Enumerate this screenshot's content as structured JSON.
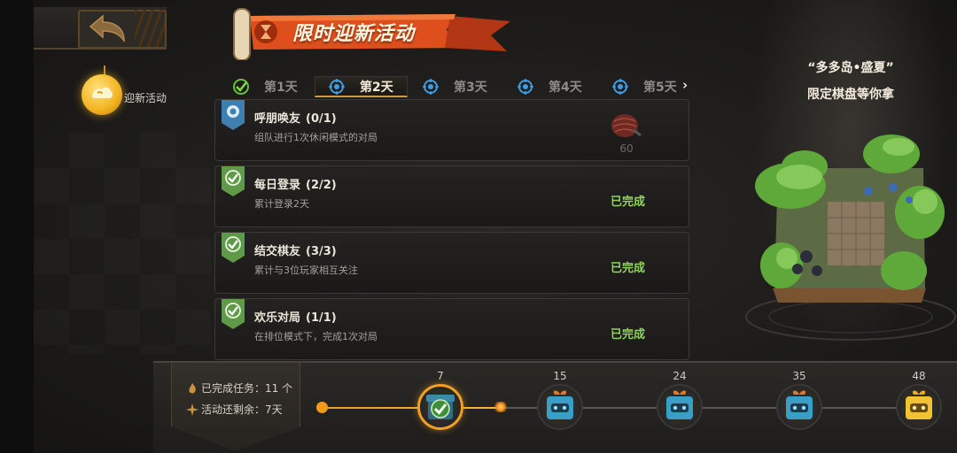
{
  "header": {
    "title": "限时迎新活动"
  },
  "side_nav": {
    "activity_label": "迎新活动"
  },
  "tabs": [
    {
      "label": "第1天",
      "state": "completed"
    },
    {
      "label": "第2天",
      "state": "active"
    },
    {
      "label": "第3天",
      "state": "locked"
    },
    {
      "label": "第4天",
      "state": "locked"
    },
    {
      "label": "第5天",
      "state": "locked"
    }
  ],
  "tasks": [
    {
      "name": "呼朋唤友",
      "progress": "(0/1)",
      "desc": "组队进行1次休闲模式的对局",
      "status": "",
      "reward": "60"
    },
    {
      "name": "每日登录",
      "progress": "(2/2)",
      "desc": "累计登录2天",
      "status": "已完成"
    },
    {
      "name": "结交棋友",
      "progress": "(3/3)",
      "desc": "累计与3位玩家相互关注",
      "status": "已完成"
    },
    {
      "name": "欢乐对局",
      "progress": "(1/1)",
      "desc": "在排位模式下，完成1次对局",
      "status": "已完成"
    }
  ],
  "promo": {
    "title": "“多多岛•盛夏”",
    "subtitle": "限定棋盘等你拿"
  },
  "summary": {
    "completed": "已完成任务：11 个",
    "remaining": "活动还剩余：7天",
    "completed_count": 11
  },
  "milestones": [
    {
      "value": "7",
      "reached": true
    },
    {
      "value": "15",
      "reached": false
    },
    {
      "value": "24",
      "reached": false
    },
    {
      "value": "35",
      "reached": false
    },
    {
      "value": "48",
      "reached": false
    }
  ],
  "colors": {
    "accent": "#f0a024",
    "done_text": "#8fd35e",
    "banner": "#e0521f",
    "check_badge": "#6aa84f"
  }
}
